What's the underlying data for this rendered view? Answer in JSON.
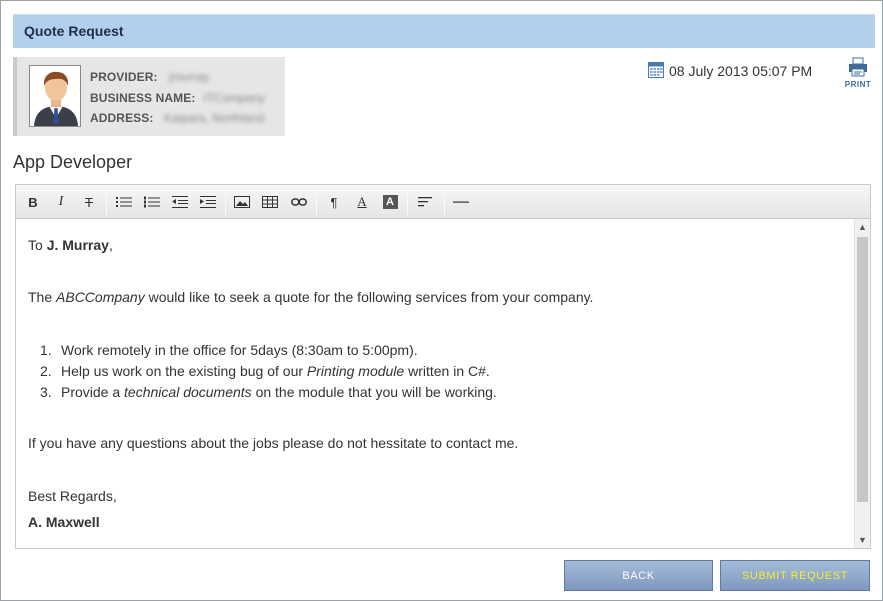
{
  "window": {
    "title": "Quote Request"
  },
  "provider": {
    "provider_label": "PROVIDER:",
    "provider_value": "jmurray",
    "business_label": "BUSINESS NAME:",
    "business_value": "ITCompany",
    "address_label": "ADDRESS:",
    "address_value": "Kaipara, Northland"
  },
  "header": {
    "date": "08 July 2013 05:07 PM",
    "print_label": "PRINT"
  },
  "subject": "App Developer",
  "toolbar": {
    "icons": [
      "bold-icon",
      "italic-icon",
      "strikethrough-icon",
      "unordered-list-icon",
      "ordered-list-icon",
      "outdent-icon",
      "indent-icon",
      "image-icon",
      "table-icon",
      "link-icon",
      "paragraph-icon",
      "font-color-icon",
      "background-color-icon",
      "align-icon",
      "horizontal-rule-icon"
    ]
  },
  "letter": {
    "greeting_prefix": "To ",
    "recipient": "J. Murray",
    "greeting_suffix": ",",
    "intro_prefix": "The ",
    "intro_company": "ABCCompany",
    "intro_suffix": " would like to seek a quote for the following services from your company.",
    "item1_num": "1.",
    "item1": "Work remotely in the office for 5days (8:30am to 5:00pm).",
    "item2_num": "2.",
    "item2_prefix": "Help us work on the existing bug of our ",
    "item2_em": "Printing module",
    "item2_suffix": " written in C#.",
    "item3_num": "3.",
    "item3_prefix": "Provide a ",
    "item3_em": "technical documents",
    "item3_suffix": " on the module that you will be working.",
    "closing_line": "If you have any questions about the jobs please do not hessitate to contact me.",
    "regards": "Best Regards,",
    "signature": "A. Maxwell"
  },
  "buttons": {
    "back": "BACK",
    "submit": "SUBMIT REQUEST"
  }
}
